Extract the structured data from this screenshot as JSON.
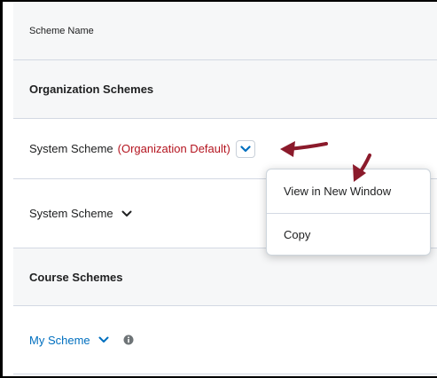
{
  "table": {
    "header": {
      "column_label": "Scheme Name"
    },
    "organization_section": {
      "title": "Organization Schemes"
    },
    "rows": [
      {
        "name": "System Scheme",
        "tag": "(Organization Default)"
      },
      {
        "name": "System Scheme"
      }
    ],
    "course_section": {
      "title": "Course Schemes"
    },
    "course_rows": [
      {
        "name": "My Scheme"
      }
    ]
  },
  "context_menu": {
    "items": [
      {
        "label": "View in New Window"
      },
      {
        "label": "Copy"
      }
    ]
  },
  "icons": {
    "row_chevron": "chevron-down-icon",
    "info": "info-icon",
    "annotation": "arrow-icon"
  },
  "colors": {
    "org_default_text": "#b4141f",
    "link_text": "#006fbf",
    "chevron_blue": "#006fbf",
    "annotation_arrow": "#8b1a2b",
    "section_background": "#f6f7f8",
    "divider": "#d3d9e3"
  }
}
